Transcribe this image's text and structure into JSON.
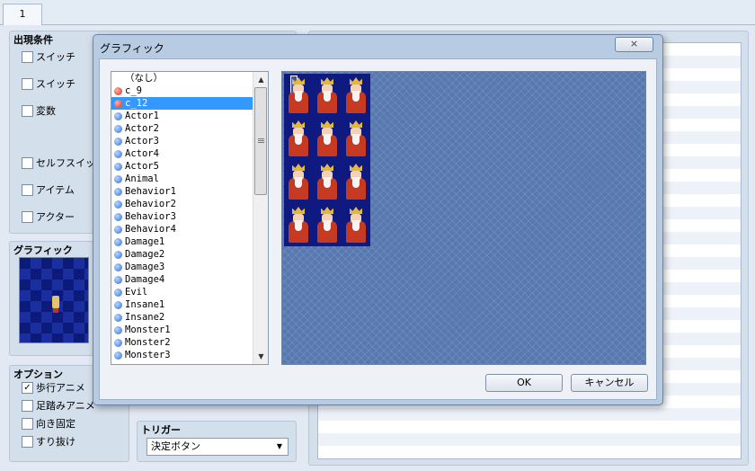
{
  "editor": {
    "tab_label": "1",
    "conditions": {
      "title": "出現条件",
      "items": [
        "スイッチ",
        "スイッチ",
        "変数",
        "セルフスイッチ",
        "アイテム",
        "アクター"
      ]
    },
    "graphic": {
      "title": "グラフィック"
    },
    "options": {
      "title": "オプション",
      "items": [
        {
          "label": "歩行アニメ",
          "checked": true
        },
        {
          "label": "足踏みアニメ",
          "checked": false
        },
        {
          "label": "向き固定",
          "checked": false
        },
        {
          "label": "すり抜け",
          "checked": false
        }
      ]
    },
    "trigger": {
      "title": "トリガー",
      "value": "決定ボタン"
    }
  },
  "dialog": {
    "title": "グラフィック",
    "close_label": "⨯",
    "files": [
      {
        "label": "（なし）",
        "icon": "none"
      },
      {
        "label": "c_9",
        "icon": "red"
      },
      {
        "label": "c_12",
        "icon": "red",
        "selected": true
      },
      {
        "label": "Actor1",
        "icon": "blue"
      },
      {
        "label": "Actor2",
        "icon": "blue"
      },
      {
        "label": "Actor3",
        "icon": "blue"
      },
      {
        "label": "Actor4",
        "icon": "blue"
      },
      {
        "label": "Actor5",
        "icon": "blue"
      },
      {
        "label": "Animal",
        "icon": "blue"
      },
      {
        "label": "Behavior1",
        "icon": "blue"
      },
      {
        "label": "Behavior2",
        "icon": "blue"
      },
      {
        "label": "Behavior3",
        "icon": "blue"
      },
      {
        "label": "Behavior4",
        "icon": "blue"
      },
      {
        "label": "Damage1",
        "icon": "blue"
      },
      {
        "label": "Damage2",
        "icon": "blue"
      },
      {
        "label": "Damage3",
        "icon": "blue"
      },
      {
        "label": "Damage4",
        "icon": "blue"
      },
      {
        "label": "Evil",
        "icon": "blue"
      },
      {
        "label": "Insane1",
        "icon": "blue"
      },
      {
        "label": "Insane2",
        "icon": "blue"
      },
      {
        "label": "Monster1",
        "icon": "blue"
      },
      {
        "label": "Monster2",
        "icon": "blue"
      },
      {
        "label": "Monster3",
        "icon": "blue"
      }
    ],
    "ok_label": "OK",
    "cancel_label": "キャンセル"
  },
  "colors": {
    "selection": "#3399ff",
    "canvas": "#5878b0",
    "sheet": "#0e1a80",
    "robe": "#c63a22",
    "crown": "#e3b93a"
  }
}
